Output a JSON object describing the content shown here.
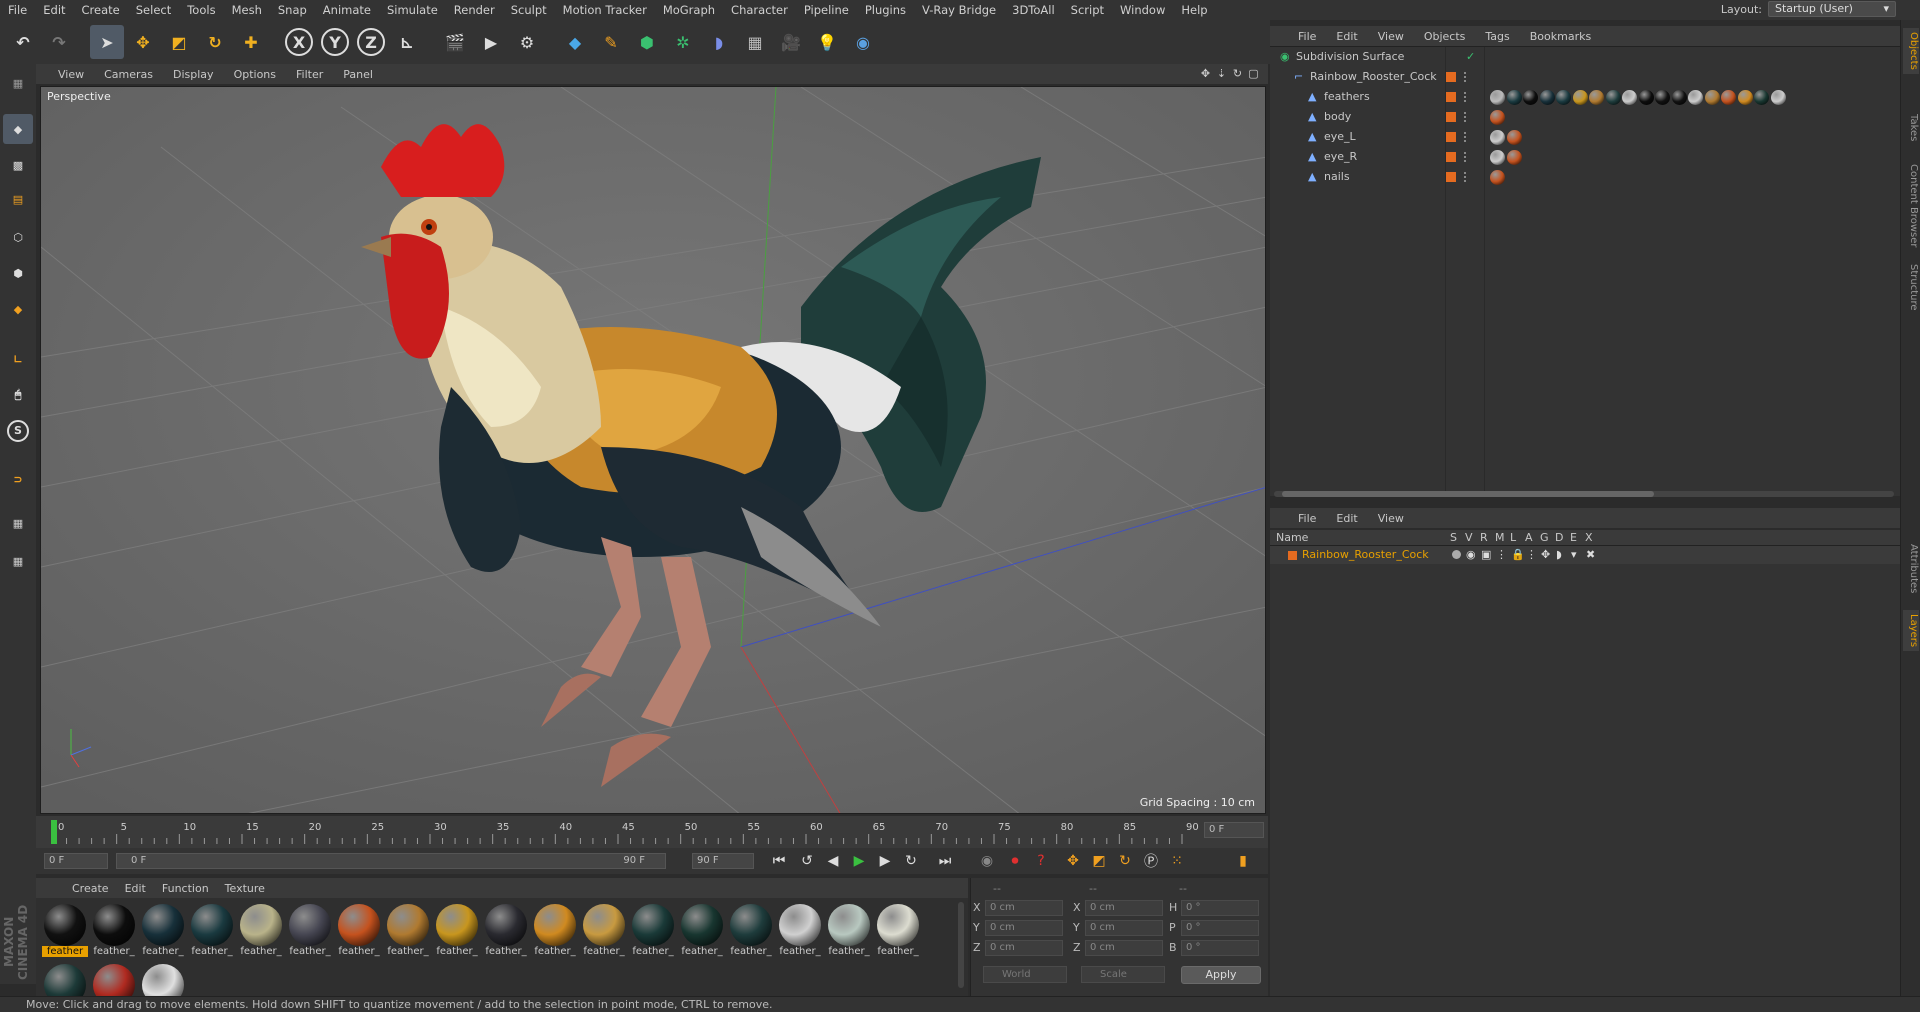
{
  "menu": [
    "File",
    "Edit",
    "Create",
    "Select",
    "Tools",
    "Mesh",
    "Snap",
    "Animate",
    "Simulate",
    "Render",
    "Sculpt",
    "Motion Tracker",
    "MoGraph",
    "Character",
    "Pipeline",
    "Plugins",
    "V-Ray Bridge",
    "3DToAll",
    "Script",
    "Window",
    "Help"
  ],
  "layout": {
    "label": "Layout:",
    "value": "Startup (User)"
  },
  "toolbar": {
    "axis_x": "X",
    "axis_y": "Y",
    "axis_z": "Z"
  },
  "viewport": {
    "menu": [
      "View",
      "Cameras",
      "Display",
      "Options",
      "Filter",
      "Panel"
    ],
    "label": "Perspective",
    "grid_spacing": "Grid Spacing : 10 cm"
  },
  "timeline": {
    "ticks": [
      "0",
      "5",
      "10",
      "15",
      "20",
      "25",
      "30",
      "35",
      "40",
      "45",
      "50",
      "55",
      "60",
      "65",
      "70",
      "75",
      "80",
      "85",
      "90"
    ],
    "current_frame": "0 F"
  },
  "transport": {
    "start": "0 F",
    "range_start": "0 F",
    "range_end": "90 F",
    "end": "90 F"
  },
  "materials": {
    "menu": [
      "Create",
      "Edit",
      "Function",
      "Texture"
    ],
    "items": [
      {
        "label": "feather",
        "color": "#111111",
        "active": true
      },
      {
        "label": "feather_",
        "color": "#0d0d0d"
      },
      {
        "label": "feather_",
        "color": "#17303a"
      },
      {
        "label": "feather_",
        "color": "#1a3a40"
      },
      {
        "label": "feather_",
        "color": "#b9b38a"
      },
      {
        "label": "feather_",
        "color": "#464652"
      },
      {
        "label": "feather_",
        "color": "#c5521e"
      },
      {
        "label": "feather_",
        "color": "#b07a30"
      },
      {
        "label": "feather_",
        "color": "#c8961e"
      },
      {
        "label": "feather_",
        "color": "#2a2a30"
      },
      {
        "label": "feather_",
        "color": "#d08a20"
      },
      {
        "label": "feather_",
        "color": "#c89a40"
      },
      {
        "label": "feather_",
        "color": "#1a3a38"
      },
      {
        "label": "feather_",
        "color": "#183630"
      },
      {
        "label": "feather_",
        "color": "#1e3c3c"
      },
      {
        "label": "feather_",
        "color": "#d0d0d0"
      },
      {
        "label": "feather_",
        "color": "#b8c8c0"
      },
      {
        "label": "feather_",
        "color": "#dcdcd0"
      },
      {
        "label": "",
        "color": "#1d3a38"
      },
      {
        "label": "",
        "color": "#b02a20"
      },
      {
        "label": "",
        "color": "#e0e0e0"
      }
    ]
  },
  "coords": {
    "header": [
      "--",
      "--",
      "--"
    ],
    "rows": [
      {
        "a": "X",
        "av": "0 cm",
        "b": "X",
        "bv": "0 cm",
        "c": "H",
        "cv": "0 °"
      },
      {
        "a": "Y",
        "av": "0 cm",
        "b": "Y",
        "bv": "0 cm",
        "c": "P",
        "cv": "0 °"
      },
      {
        "a": "Z",
        "av": "0 cm",
        "b": "Z",
        "bv": "0 cm",
        "c": "B",
        "cv": "0 °"
      }
    ],
    "space": "World",
    "mode": "Scale",
    "apply": "Apply"
  },
  "status": "Move: Click and drag to move elements. Hold down SHIFT to quantize movement / add to the selection in point mode, CTRL to remove.",
  "objects": {
    "menu": [
      "File",
      "Edit",
      "View",
      "Objects",
      "Tags",
      "Bookmarks"
    ],
    "items": [
      {
        "name": "Subdivision Surface",
        "indent": 0
      },
      {
        "name": "Rainbow_Rooster_Cock",
        "indent": 1
      },
      {
        "name": "feathers",
        "indent": 2
      },
      {
        "name": "body",
        "indent": 2
      },
      {
        "name": "eye_L",
        "indent": 2
      },
      {
        "name": "eye_R",
        "indent": 2
      },
      {
        "name": "nails",
        "indent": 2
      }
    ]
  },
  "layers": {
    "menu": [
      "File",
      "Edit",
      "View"
    ],
    "columns": [
      "Name",
      "S",
      "V",
      "R",
      "M",
      "L",
      "A",
      "G",
      "D",
      "E",
      "X"
    ],
    "row": "Rainbow_Rooster_Cock",
    "accent": "#e8a000"
  },
  "vtabs": [
    "Objects",
    "Takes",
    "Content Browser",
    "Structure",
    "Attributes",
    "Layers"
  ]
}
